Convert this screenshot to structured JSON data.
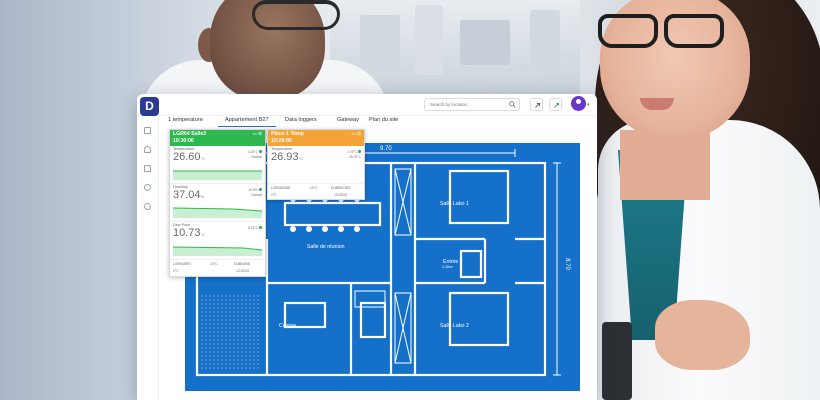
{
  "app": {
    "logo_letter": "D",
    "search_placeholder": "Search by location...",
    "tabs": [
      "1 temperature",
      "Appartement B27",
      "Data loggers",
      "Gateway",
      "Plan du site"
    ],
    "active_tab": "Appartement B27"
  },
  "floor_plan": {
    "dimension_top": "9.70",
    "dimension_right": "8.70",
    "rooms": {
      "salle_labo_1": "Salle Labo 1",
      "salle_de_reunion": "Salle de réunion",
      "entree": "Entrée",
      "entree_sub": "1.45m²",
      "cuisine": "Cuisine",
      "salle_labo_2": "Salle Labo 2"
    }
  },
  "cards": [
    {
      "name": "LGR64 Salle2",
      "time": "10:30:00",
      "color": "#2fb84f",
      "metrics": [
        {
          "label": "Temperature",
          "value": "26.60",
          "unit": "°C",
          "side1": "4.25°C",
          "side2": "Normal"
        },
        {
          "label": "Humidity",
          "value": "37.04",
          "unit": "%",
          "side1": "40.8%",
          "side2": "Normal"
        },
        {
          "label": "Dew Point",
          "value": "10.73",
          "unit": "°C",
          "side1": "8.18°C",
          "side2": ""
        }
      ],
      "footer": {
        "left": "LGR64SRD",
        "mid": "10°C",
        "right": "DUBNS98",
        "sub_left": "1°C",
        "sub_mid": "",
        "sub_right": "10:30:00"
      }
    },
    {
      "name": "Pièce 1 Temp",
      "time": "10:29:00",
      "color": "#f3a437",
      "metrics": [
        {
          "label": "Temperature",
          "value": "26.93",
          "unit": "°C",
          "side1": "4.75°C",
          "side2": "26.93°C"
        }
      ],
      "footer": {
        "left": "LGR0D0068",
        "mid": "10°C",
        "right": "DUBSN7892",
        "sub_left": "1°C",
        "sub_mid": "",
        "sub_right": "10:29:00"
      }
    }
  ],
  "colors": {
    "plan_blue": "#1570c9",
    "tab_accent": "#2d6edb",
    "avatar": "#6a33c9"
  }
}
